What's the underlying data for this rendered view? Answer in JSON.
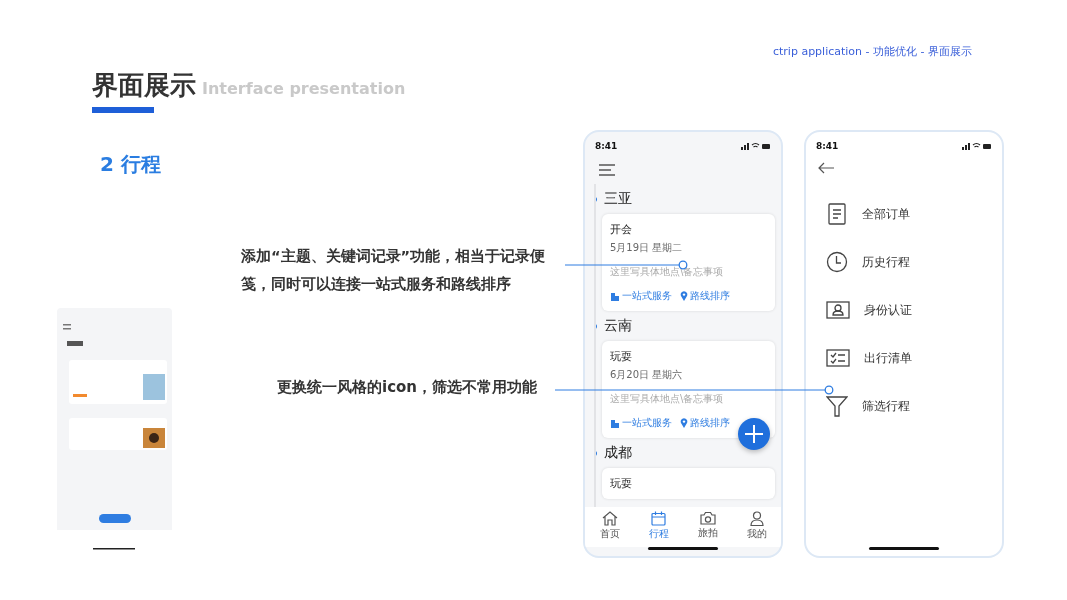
{
  "header_note": "ctrip application - 功能优化 - 界面展示",
  "title": "界面展示",
  "subtitle": "Interface presentation",
  "section": "2 行程",
  "annotations": [
    {
      "text": "添加“主题、关键词记录”功能，相当于记录便笺，同时可以连接一站式服务和路线排序"
    },
    {
      "text": "更换统一风格的icon，筛选不常用功能"
    }
  ],
  "itinerary_phone": {
    "time": "8:41",
    "groups": [
      {
        "city": "三亚",
        "card": {
          "title": "开会",
          "date": "5月19日 星期二",
          "memo": "这里写具体地点\\备忘事项",
          "service": "一站式服务",
          "route": "路线排序"
        }
      },
      {
        "city": "云南",
        "card": {
          "title": "玩耍",
          "date": "6月20日 星期六",
          "memo": "这里写具体地点\\备忘事项",
          "service": "一站式服务",
          "route": "路线排序"
        }
      },
      {
        "city": "成都",
        "card": {
          "title": "玩耍"
        }
      }
    ],
    "tabs": [
      {
        "label": "首页",
        "kind": "home",
        "selected": false
      },
      {
        "label": "行程",
        "kind": "calendar",
        "selected": true
      },
      {
        "label": "旅拍",
        "kind": "camera",
        "selected": false
      },
      {
        "label": "我的",
        "kind": "person",
        "selected": false
      }
    ]
  },
  "menu_phone": {
    "time": "8:41",
    "items": [
      {
        "label": "全部订单",
        "kind": "orders"
      },
      {
        "label": "历史行程",
        "kind": "history"
      },
      {
        "label": "身份认证",
        "kind": "identity"
      },
      {
        "label": "出行清单",
        "kind": "checklist"
      },
      {
        "label": "筛选行程",
        "kind": "filter"
      }
    ]
  }
}
